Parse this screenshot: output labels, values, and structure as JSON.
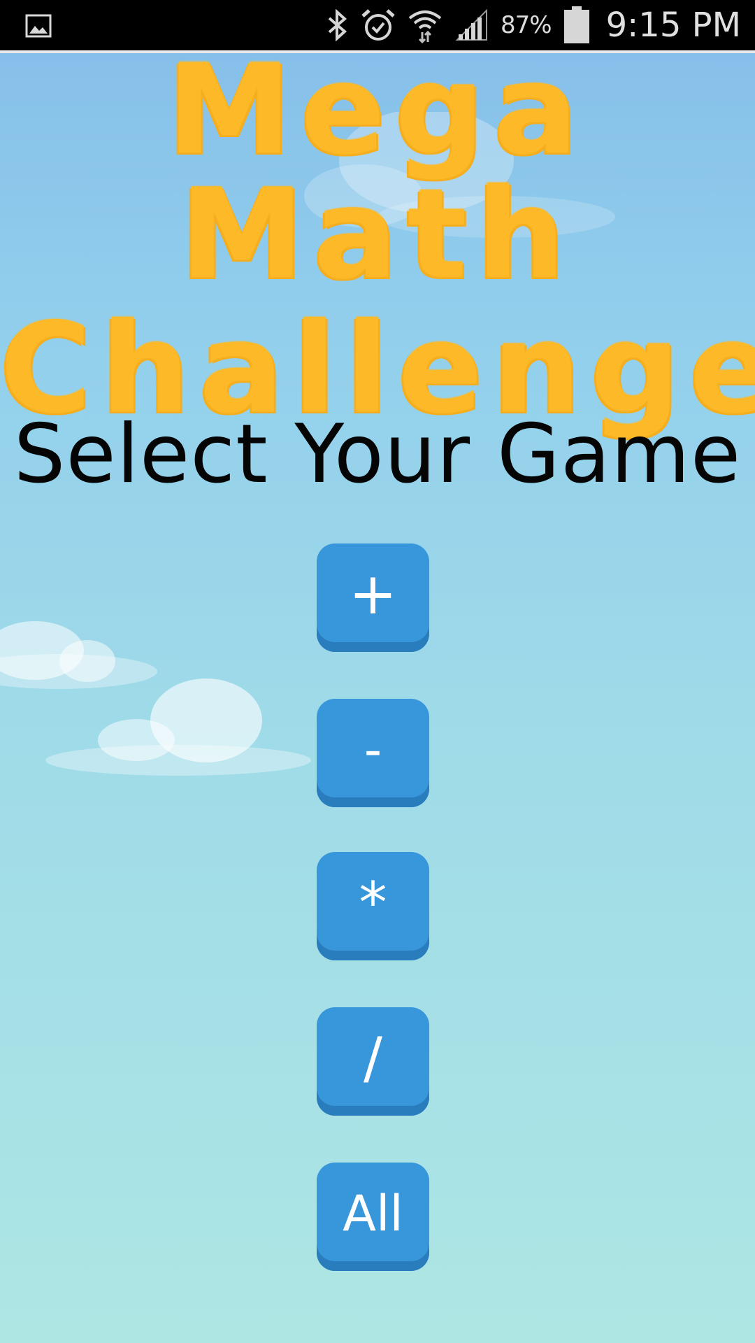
{
  "status_bar": {
    "battery_percent": "87%",
    "time": "9:15 PM",
    "icons": [
      "gallery-icon",
      "bluetooth-icon",
      "alarm-icon",
      "wifi-icon",
      "signal-icon",
      "battery-icon"
    ]
  },
  "title": {
    "line1": "Mega Math",
    "line2": "Challenge",
    "color": "#fdb927"
  },
  "heading": "Select Your Game",
  "buttons": {
    "addition": "+",
    "subtraction": "-",
    "multiplication": "*",
    "division": "/",
    "all": "All"
  },
  "colors": {
    "button_bg": "#3897db",
    "button_shadow": "#2a7dbd",
    "sky_top": "#84bde9",
    "sky_bottom": "#aee6e4"
  }
}
